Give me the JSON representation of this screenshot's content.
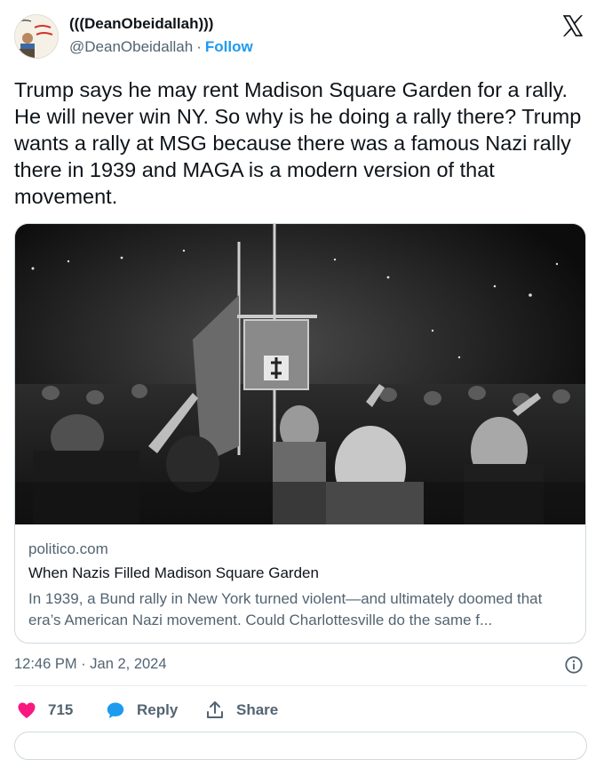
{
  "author": {
    "display_name": "(((DeanObeidallah)))",
    "handle": "@DeanObeidallah",
    "separator": "·",
    "follow_label": "Follow"
  },
  "tweet": {
    "text": "Trump says he may rent Madison Square Garden for a rally. He will never win NY. So why is he doing a rally there? Trump wants a rally at MSG because there was a famous Nazi rally there in 1939 and MAGA is a modern version of that movement."
  },
  "link_card": {
    "domain": "politico.com",
    "title": "When Nazis Filled Madison Square Garden",
    "description": "In 1939, a Bund rally in New York turned violent—and ultimately doomed that era’s American Nazi movement. Could Charlottesville do the same f..."
  },
  "meta": {
    "timestamp": "12:46 PM · Jan 2, 2024"
  },
  "actions": {
    "like_count": "715",
    "reply_label": "Reply",
    "share_label": "Share"
  },
  "icons": {
    "header": "x-logo-icon",
    "info": "info-icon",
    "like": "heart-icon",
    "reply": "speech-bubble-icon",
    "share": "share-upload-icon"
  },
  "colors": {
    "accent": "#1d9bf0",
    "like": "#f91880",
    "secondary_text": "#536471",
    "border": "#cfd9de"
  }
}
